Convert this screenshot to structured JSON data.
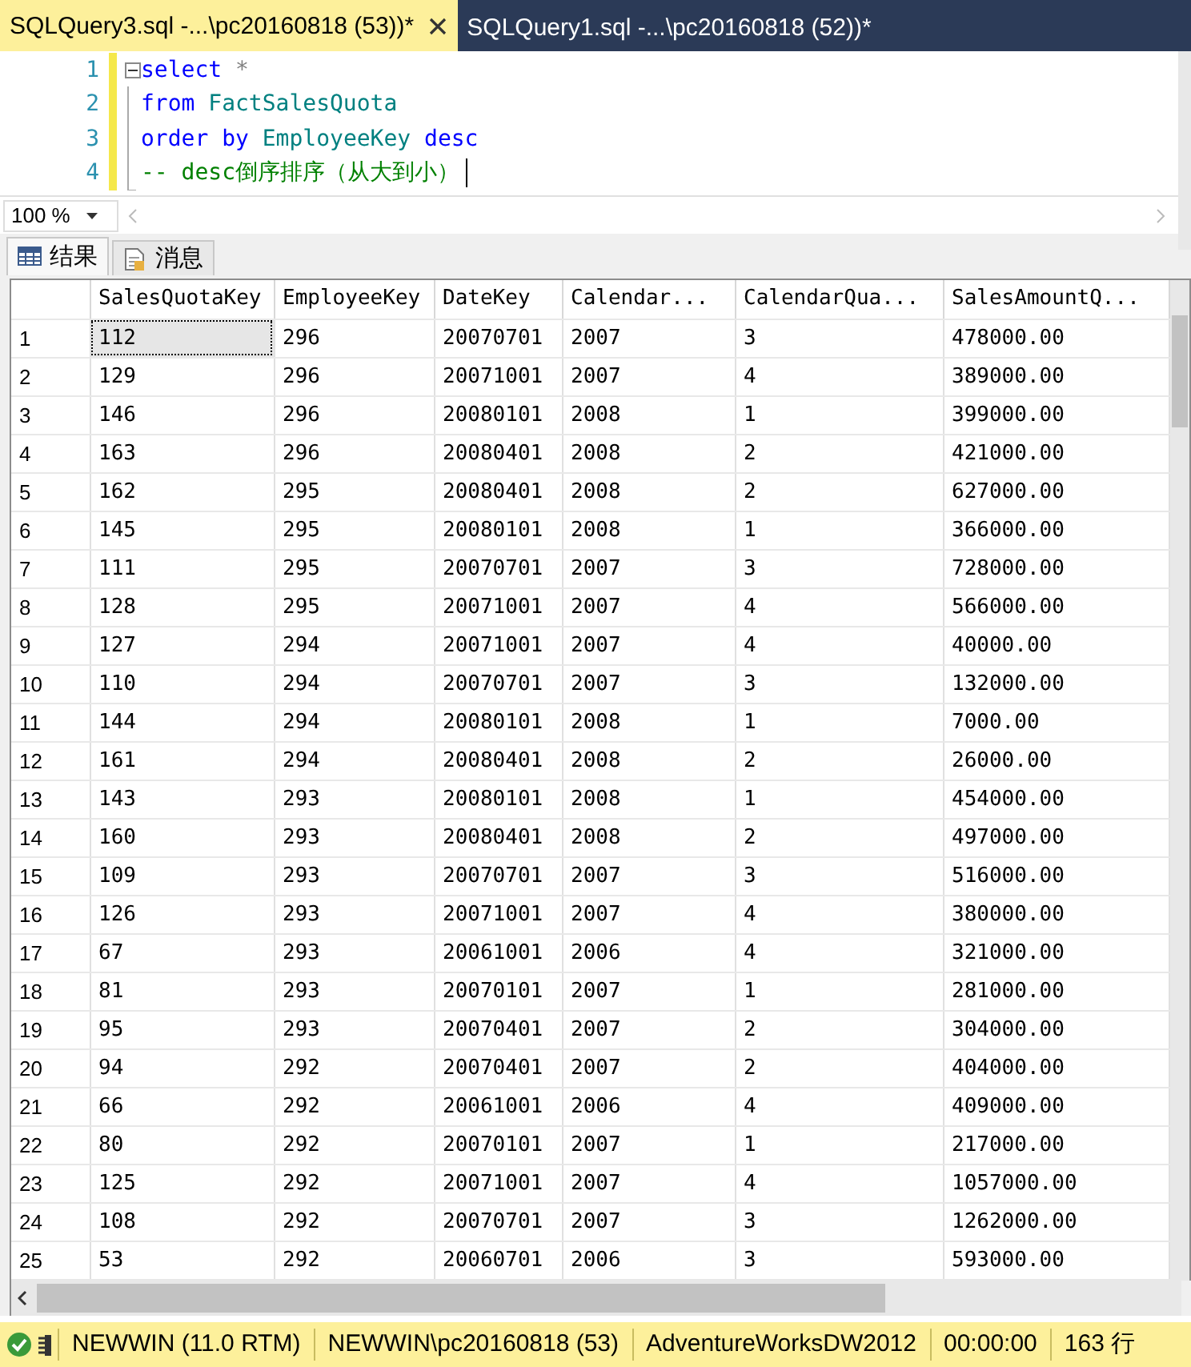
{
  "document_tabs": [
    {
      "label": "SQLQuery3.sql -...\\pc20160818 (53))*",
      "selected": true
    },
    {
      "label": "SQLQuery1.sql -...\\pc20160818 (52))*",
      "selected": false
    }
  ],
  "editor": {
    "lines": [
      {
        "number": "1",
        "modified": true,
        "cursor": false,
        "tokens": [
          {
            "kind": "keyword",
            "text": "select"
          },
          {
            "kind": "operator",
            "text": " *"
          }
        ]
      },
      {
        "number": "2",
        "modified": true,
        "cursor": false,
        "tokens": [
          {
            "kind": "keyword",
            "text": "from"
          },
          {
            "kind": "identifier",
            "text": " FactSalesQuota"
          }
        ]
      },
      {
        "number": "3",
        "modified": true,
        "cursor": false,
        "tokens": [
          {
            "kind": "keyword",
            "text": "order by"
          },
          {
            "kind": "identifier",
            "text": " EmployeeKey"
          },
          {
            "kind": "keyword",
            "text": " desc"
          }
        ]
      },
      {
        "number": "4",
        "modified": true,
        "cursor": true,
        "tokens": [
          {
            "kind": "comment",
            "text": "-- desc倒序排序（从大到小）"
          }
        ]
      }
    ],
    "zoom": "100 %"
  },
  "result_tabs": [
    {
      "label": "结果",
      "kind": "grid",
      "selected": true
    },
    {
      "label": "消息",
      "kind": "messages",
      "selected": false
    }
  ],
  "grid": {
    "columns": [
      "SalesQuotaKey",
      "EmployeeKey",
      "DateKey",
      "Calendar...",
      "CalendarQua...",
      "SalesAmountQ..."
    ],
    "rows": [
      {
        "number": "1",
        "focused": true,
        "cells": [
          "112",
          "296",
          "20070701",
          "2007",
          "3",
          "478000.00"
        ]
      },
      {
        "number": "2",
        "focused": false,
        "cells": [
          "129",
          "296",
          "20071001",
          "2007",
          "4",
          "389000.00"
        ]
      },
      {
        "number": "3",
        "focused": false,
        "cells": [
          "146",
          "296",
          "20080101",
          "2008",
          "1",
          "399000.00"
        ]
      },
      {
        "number": "4",
        "focused": false,
        "cells": [
          "163",
          "296",
          "20080401",
          "2008",
          "2",
          "421000.00"
        ]
      },
      {
        "number": "5",
        "focused": false,
        "cells": [
          "162",
          "295",
          "20080401",
          "2008",
          "2",
          "627000.00"
        ]
      },
      {
        "number": "6",
        "focused": false,
        "cells": [
          "145",
          "295",
          "20080101",
          "2008",
          "1",
          "366000.00"
        ]
      },
      {
        "number": "7",
        "focused": false,
        "cells": [
          "111",
          "295",
          "20070701",
          "2007",
          "3",
          "728000.00"
        ]
      },
      {
        "number": "8",
        "focused": false,
        "cells": [
          "128",
          "295",
          "20071001",
          "2007",
          "4",
          "566000.00"
        ]
      },
      {
        "number": "9",
        "focused": false,
        "cells": [
          "127",
          "294",
          "20071001",
          "2007",
          "4",
          "40000.00"
        ]
      },
      {
        "number": "10",
        "focused": false,
        "cells": [
          "110",
          "294",
          "20070701",
          "2007",
          "3",
          "132000.00"
        ]
      },
      {
        "number": "11",
        "focused": false,
        "cells": [
          "144",
          "294",
          "20080101",
          "2008",
          "1",
          "7000.00"
        ]
      },
      {
        "number": "12",
        "focused": false,
        "cells": [
          "161",
          "294",
          "20080401",
          "2008",
          "2",
          "26000.00"
        ]
      },
      {
        "number": "13",
        "focused": false,
        "cells": [
          "143",
          "293",
          "20080101",
          "2008",
          "1",
          "454000.00"
        ]
      },
      {
        "number": "14",
        "focused": false,
        "cells": [
          "160",
          "293",
          "20080401",
          "2008",
          "2",
          "497000.00"
        ]
      },
      {
        "number": "15",
        "focused": false,
        "cells": [
          "109",
          "293",
          "20070701",
          "2007",
          "3",
          "516000.00"
        ]
      },
      {
        "number": "16",
        "focused": false,
        "cells": [
          "126",
          "293",
          "20071001",
          "2007",
          "4",
          "380000.00"
        ]
      },
      {
        "number": "17",
        "focused": false,
        "cells": [
          "67",
          "293",
          "20061001",
          "2006",
          "4",
          "321000.00"
        ]
      },
      {
        "number": "18",
        "focused": false,
        "cells": [
          "81",
          "293",
          "20070101",
          "2007",
          "1",
          "281000.00"
        ]
      },
      {
        "number": "19",
        "focused": false,
        "cells": [
          "95",
          "293",
          "20070401",
          "2007",
          "2",
          "304000.00"
        ]
      },
      {
        "number": "20",
        "focused": false,
        "cells": [
          "94",
          "292",
          "20070401",
          "2007",
          "2",
          "404000.00"
        ]
      },
      {
        "number": "21",
        "focused": false,
        "cells": [
          "66",
          "292",
          "20061001",
          "2006",
          "4",
          "409000.00"
        ]
      },
      {
        "number": "22",
        "focused": false,
        "cells": [
          "80",
          "292",
          "20070101",
          "2007",
          "1",
          "217000.00"
        ]
      },
      {
        "number": "23",
        "focused": false,
        "cells": [
          "125",
          "292",
          "20071001",
          "2007",
          "4",
          "1057000.00"
        ]
      },
      {
        "number": "24",
        "focused": false,
        "cells": [
          "108",
          "292",
          "20070701",
          "2007",
          "3",
          "1262000.00"
        ]
      },
      {
        "number": "25",
        "focused": false,
        "cells": [
          "53",
          "292",
          "20060701",
          "2006",
          "3",
          "593000.00"
        ]
      }
    ]
  },
  "status_bar": {
    "items": [
      "NEWWIN (11.0 RTM)",
      "NEWWIN\\pc20160818 (53)",
      "AdventureWorksDW2012",
      "00:00:00",
      "163 行"
    ]
  }
}
